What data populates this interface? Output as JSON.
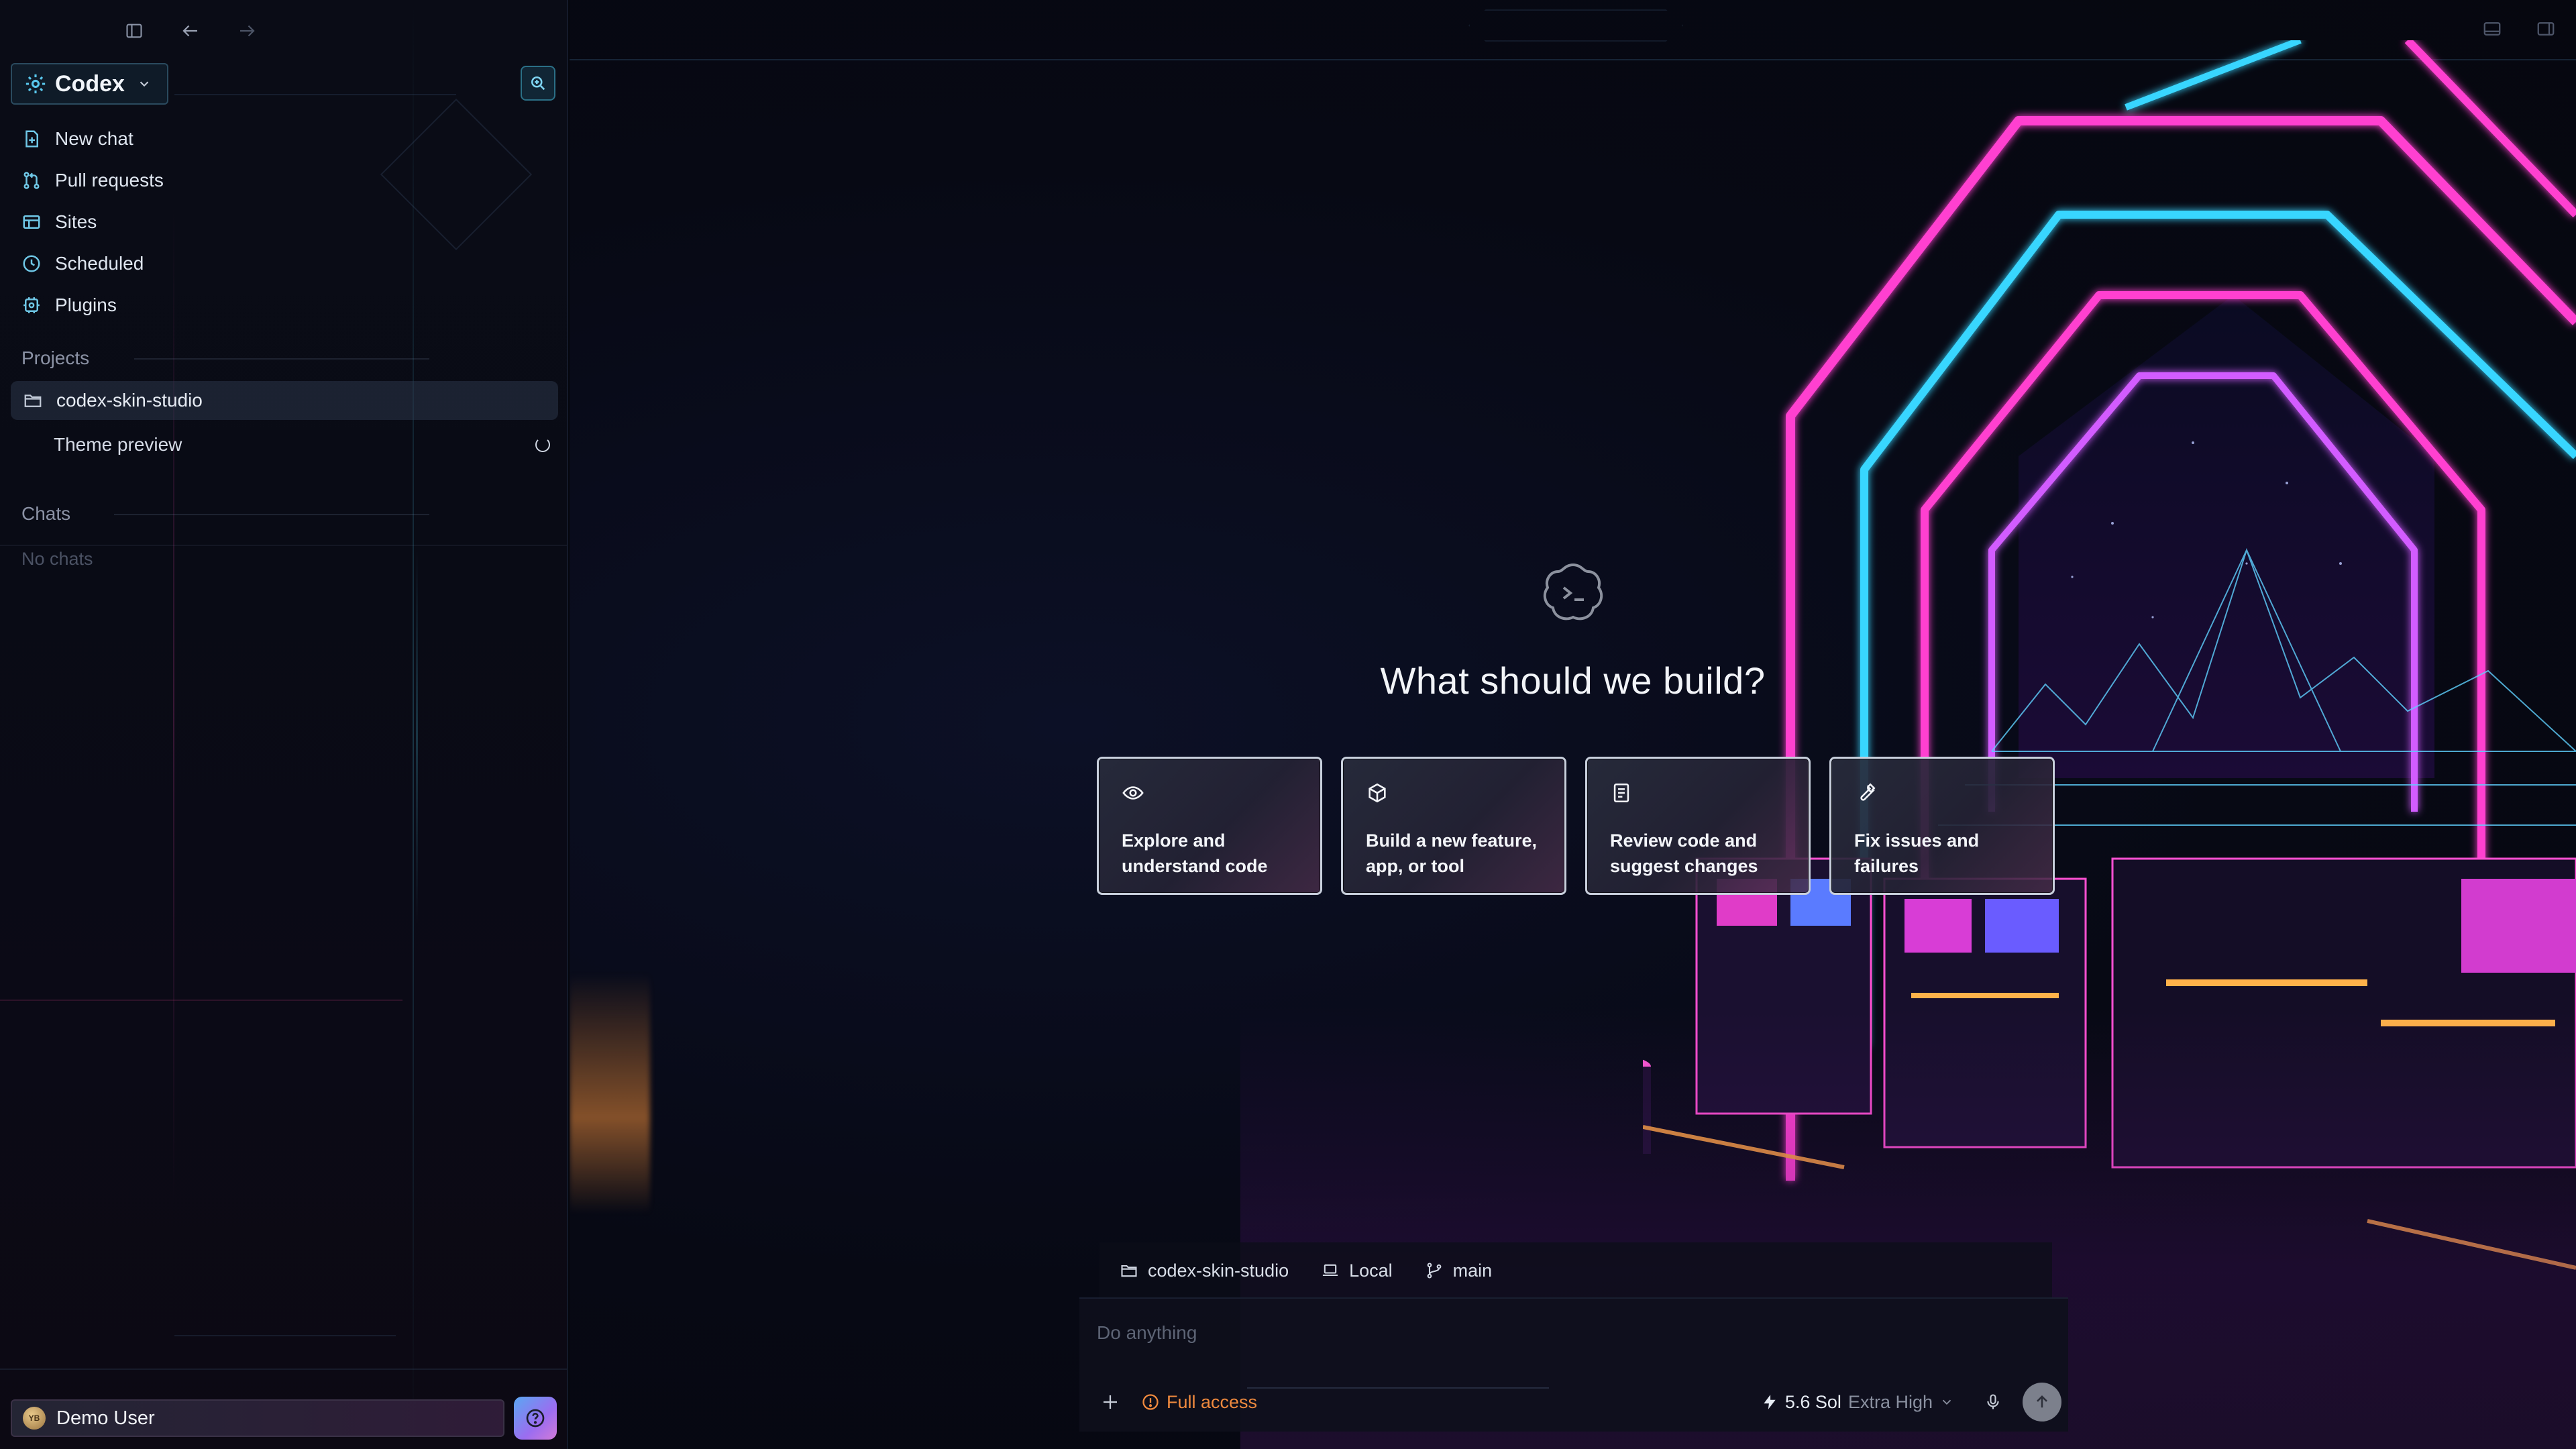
{
  "app": {
    "name": "Codex"
  },
  "sidebar": {
    "nav": [
      {
        "label": "New chat",
        "icon": "new-chat-icon"
      },
      {
        "label": "Pull requests",
        "icon": "pull-request-icon"
      },
      {
        "label": "Sites",
        "icon": "sites-icon"
      },
      {
        "label": "Scheduled",
        "icon": "clock-icon"
      },
      {
        "label": "Plugins",
        "icon": "plugin-icon"
      }
    ],
    "projects_label": "Projects",
    "project": "codex-skin-studio",
    "project_thread": "Theme preview",
    "chats_label": "Chats",
    "chats_empty": "No chats",
    "user": {
      "name": "Demo User",
      "initials": "YB"
    }
  },
  "main": {
    "title": "What should we build?",
    "cards": [
      {
        "text": "Explore and understand code",
        "icon": "eye-icon"
      },
      {
        "text": "Build a new feature, app, or tool",
        "icon": "cube-icon"
      },
      {
        "text": "Review code and suggest changes",
        "icon": "document-icon"
      },
      {
        "text": "Fix issues and failures",
        "icon": "wrench-icon"
      }
    ]
  },
  "composer": {
    "context": {
      "project": "codex-skin-studio",
      "env": "Local",
      "branch": "main"
    },
    "placeholder": "Do anything",
    "access": "Full access",
    "model": "5.6 Sol",
    "effort": "Extra High"
  },
  "colors": {
    "accent_teal": "#2b6f86",
    "access_orange": "#f08a3e",
    "neon_pink": "#ff3fd0",
    "neon_cyan": "#38d6ff"
  }
}
